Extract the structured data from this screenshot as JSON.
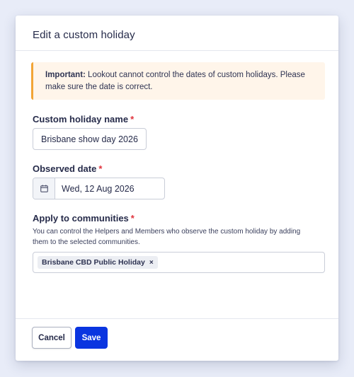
{
  "modal": {
    "title": "Edit a custom holiday"
  },
  "alert": {
    "strong": "Important:",
    "text": " Lookout cannot control the dates of custom holidays. Please make sure the date is correct."
  },
  "fields": {
    "name": {
      "label": "Custom holiday name",
      "required_mark": "*",
      "value": "Brisbane show day 2026"
    },
    "date": {
      "label": "Observed date",
      "required_mark": "*",
      "value": "Wed, 12 Aug 2026",
      "icon": "calendar-icon"
    },
    "communities": {
      "label": "Apply to communities",
      "required_mark": "*",
      "help": "You can control the Helpers and Members who observe the custom holiday by adding them to the selected communities.",
      "selected": [
        {
          "label": "Brisbane CBD Public Holiday",
          "remove_glyph": "×"
        }
      ]
    }
  },
  "footer": {
    "cancel_label": "Cancel",
    "save_label": "Save"
  },
  "colors": {
    "primary": "#0a35e0",
    "warning_accent": "#f2a436",
    "warning_bg": "#fff5ea",
    "required": "#e0333d"
  }
}
